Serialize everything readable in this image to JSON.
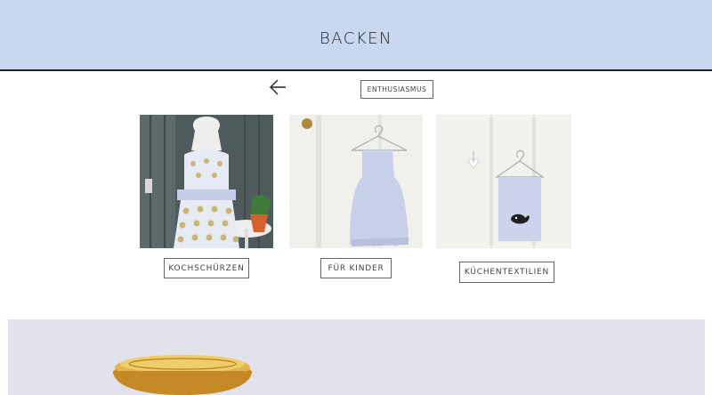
{
  "header": {
    "title": "BACKEN"
  },
  "nav": {
    "tag_label": "ENTHUSIASMUS"
  },
  "cards": [
    {
      "label": "KOCHSCHÜRZEN"
    },
    {
      "label": "FÜR KINDER"
    },
    {
      "label": "KÜCHENTEXTILIEN"
    }
  ],
  "colors": {
    "header_bg": "#c9d8f0",
    "banner_bg": "#e2e2ec"
  },
  "icons": {
    "back": "arrow-left-icon"
  }
}
